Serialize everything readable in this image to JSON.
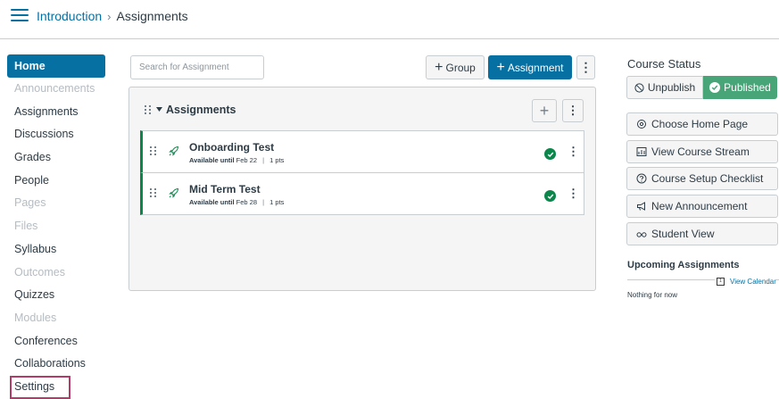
{
  "breadcrumb": {
    "course": "Introduction",
    "separator": "›",
    "current": "Assignments"
  },
  "nav": {
    "items": [
      {
        "label": "Home"
      },
      {
        "label": "Announcements"
      },
      {
        "label": "Assignments"
      },
      {
        "label": "Discussions"
      },
      {
        "label": "Grades"
      },
      {
        "label": "People"
      },
      {
        "label": "Pages"
      },
      {
        "label": "Files"
      },
      {
        "label": "Syllabus"
      },
      {
        "label": "Outcomes"
      },
      {
        "label": "Quizzes"
      },
      {
        "label": "Modules"
      },
      {
        "label": "Conferences"
      },
      {
        "label": "Collaborations"
      },
      {
        "label": "Settings"
      }
    ]
  },
  "toolbar": {
    "search_placeholder": "Search for Assignment",
    "group_label": "Group",
    "assignment_label": "Assignment",
    "kebab": "⋮",
    "plus": "+"
  },
  "group": {
    "title": "Assignments",
    "assignments": [
      {
        "title": "Onboarding Test",
        "available_label": "Available until",
        "date": "Feb 22",
        "points": "1 pts"
      },
      {
        "title": "Mid Term Test",
        "available_label": "Available until",
        "date": "Feb 28",
        "points": "1 pts"
      }
    ]
  },
  "sidebar": {
    "course_status_title": "Course Status",
    "unpublish_label": "Unpublish",
    "published_label": "Published",
    "buttons": [
      {
        "label": "Choose Home Page",
        "icon": "settings-icon"
      },
      {
        "label": "View Course Stream",
        "icon": "stream-icon"
      },
      {
        "label": "Course Setup Checklist",
        "icon": "question-icon"
      },
      {
        "label": "New Announcement",
        "icon": "announcement-icon"
      },
      {
        "label": "Student View",
        "icon": "glasses-icon"
      }
    ],
    "upcoming_title": "Upcoming Assignments",
    "view_calendar": "View Calendar",
    "calendar_day": "1",
    "nothing_for_now": "Nothing for now"
  },
  "colors": {
    "brand": "#0770a3",
    "success": "#0b874b",
    "highlight": "#b33b6a"
  }
}
